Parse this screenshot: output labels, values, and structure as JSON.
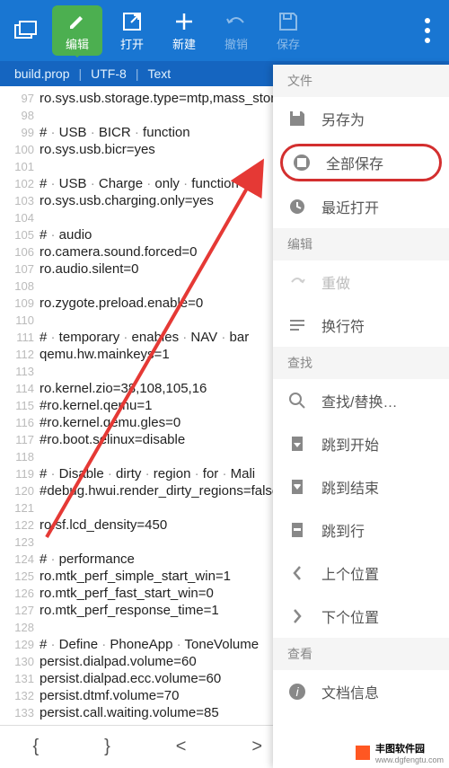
{
  "toolbar": {
    "edit": "编辑",
    "open": "打开",
    "new": "新建",
    "undo": "撤销",
    "save": "保存"
  },
  "status": {
    "file": "build.prop",
    "enc": "UTF-8",
    "mode": "Text"
  },
  "lines_start": 97,
  "code": [
    "ro.sys.usb.storage.type=mtp,mass_storage",
    "",
    "# · USB · BICR · function",
    "ro.sys.usb.bicr=yes",
    "",
    "# · USB · Charge · only · function",
    "ro.sys.usb.charging.only=yes",
    "",
    "# · audio",
    "ro.camera.sound.forced=0",
    "ro.audio.silent=0",
    "",
    "ro.zygote.preload.enable=0",
    "",
    "# · temporary · enables · NAV · bar",
    "qemu.hw.mainkeys=1",
    "",
    "ro.kernel.zio=38,108,105,16",
    "#ro.kernel.qemu=1",
    "#ro.kernel.qemu.gles=0",
    "#ro.boot.selinux=disable",
    "",
    "# · Disable · dirty · region · for · Mali",
    "#debug.hwui.render_dirty_regions=false",
    "",
    "ro.sf.lcd_density=450",
    "",
    "# · performance",
    "ro.mtk_perf_simple_start_win=1",
    "ro.mtk_perf_fast_start_win=0",
    "ro.mtk_perf_response_time=1",
    "",
    "# · Define · PhoneApp · ToneVolume",
    "persist.dialpad.volume=60",
    "persist.dialpad.ecc.volume=60",
    "persist.dtmf.volume=70",
    "persist.call.waiting.volume=85"
  ],
  "menu": {
    "sect_file": "文件",
    "save_as": "另存为",
    "save_all": "全部保存",
    "recent": "最近打开",
    "sect_edit": "编辑",
    "redo": "重做",
    "wrap": "换行符",
    "sect_find": "查找",
    "find_replace": "查找/替换…",
    "go_start": "跳到开始",
    "go_end": "跳到结束",
    "go_line": "跳到行",
    "prev_pos": "上个位置",
    "next_pos": "下个位置",
    "sect_view": "查看",
    "doc_info": "文档信息"
  },
  "bottom": {
    "b1": "{",
    "b2": "}",
    "b3": "<",
    "b4": ">",
    "b5": ","
  },
  "watermark": {
    "brand": "丰图软件园",
    "url": "www.dgfengtu.com"
  }
}
